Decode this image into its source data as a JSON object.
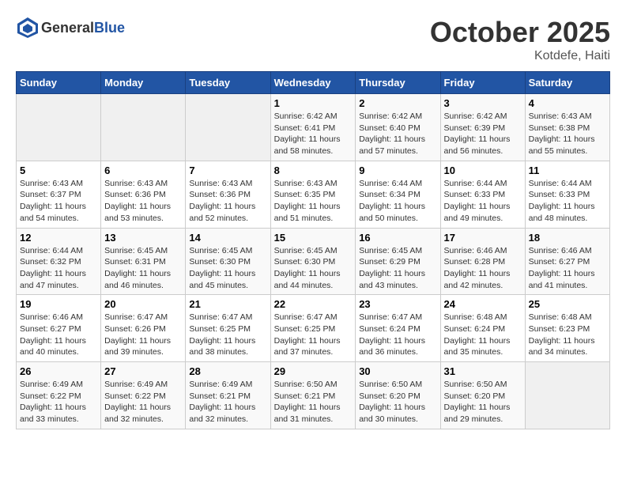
{
  "header": {
    "logo_general": "General",
    "logo_blue": "Blue",
    "month": "October 2025",
    "location": "Kotdefe, Haiti"
  },
  "weekdays": [
    "Sunday",
    "Monday",
    "Tuesday",
    "Wednesday",
    "Thursday",
    "Friday",
    "Saturday"
  ],
  "weeks": [
    [
      {
        "day": "",
        "sunrise": "",
        "sunset": "",
        "daylight": ""
      },
      {
        "day": "",
        "sunrise": "",
        "sunset": "",
        "daylight": ""
      },
      {
        "day": "",
        "sunrise": "",
        "sunset": "",
        "daylight": ""
      },
      {
        "day": "1",
        "sunrise": "Sunrise: 6:42 AM",
        "sunset": "Sunset: 6:41 PM",
        "daylight": "Daylight: 11 hours and 58 minutes."
      },
      {
        "day": "2",
        "sunrise": "Sunrise: 6:42 AM",
        "sunset": "Sunset: 6:40 PM",
        "daylight": "Daylight: 11 hours and 57 minutes."
      },
      {
        "day": "3",
        "sunrise": "Sunrise: 6:42 AM",
        "sunset": "Sunset: 6:39 PM",
        "daylight": "Daylight: 11 hours and 56 minutes."
      },
      {
        "day": "4",
        "sunrise": "Sunrise: 6:43 AM",
        "sunset": "Sunset: 6:38 PM",
        "daylight": "Daylight: 11 hours and 55 minutes."
      }
    ],
    [
      {
        "day": "5",
        "sunrise": "Sunrise: 6:43 AM",
        "sunset": "Sunset: 6:37 PM",
        "daylight": "Daylight: 11 hours and 54 minutes."
      },
      {
        "day": "6",
        "sunrise": "Sunrise: 6:43 AM",
        "sunset": "Sunset: 6:36 PM",
        "daylight": "Daylight: 11 hours and 53 minutes."
      },
      {
        "day": "7",
        "sunrise": "Sunrise: 6:43 AM",
        "sunset": "Sunset: 6:36 PM",
        "daylight": "Daylight: 11 hours and 52 minutes."
      },
      {
        "day": "8",
        "sunrise": "Sunrise: 6:43 AM",
        "sunset": "Sunset: 6:35 PM",
        "daylight": "Daylight: 11 hours and 51 minutes."
      },
      {
        "day": "9",
        "sunrise": "Sunrise: 6:44 AM",
        "sunset": "Sunset: 6:34 PM",
        "daylight": "Daylight: 11 hours and 50 minutes."
      },
      {
        "day": "10",
        "sunrise": "Sunrise: 6:44 AM",
        "sunset": "Sunset: 6:33 PM",
        "daylight": "Daylight: 11 hours and 49 minutes."
      },
      {
        "day": "11",
        "sunrise": "Sunrise: 6:44 AM",
        "sunset": "Sunset: 6:33 PM",
        "daylight": "Daylight: 11 hours and 48 minutes."
      }
    ],
    [
      {
        "day": "12",
        "sunrise": "Sunrise: 6:44 AM",
        "sunset": "Sunset: 6:32 PM",
        "daylight": "Daylight: 11 hours and 47 minutes."
      },
      {
        "day": "13",
        "sunrise": "Sunrise: 6:45 AM",
        "sunset": "Sunset: 6:31 PM",
        "daylight": "Daylight: 11 hours and 46 minutes."
      },
      {
        "day": "14",
        "sunrise": "Sunrise: 6:45 AM",
        "sunset": "Sunset: 6:30 PM",
        "daylight": "Daylight: 11 hours and 45 minutes."
      },
      {
        "day": "15",
        "sunrise": "Sunrise: 6:45 AM",
        "sunset": "Sunset: 6:30 PM",
        "daylight": "Daylight: 11 hours and 44 minutes."
      },
      {
        "day": "16",
        "sunrise": "Sunrise: 6:45 AM",
        "sunset": "Sunset: 6:29 PM",
        "daylight": "Daylight: 11 hours and 43 minutes."
      },
      {
        "day": "17",
        "sunrise": "Sunrise: 6:46 AM",
        "sunset": "Sunset: 6:28 PM",
        "daylight": "Daylight: 11 hours and 42 minutes."
      },
      {
        "day": "18",
        "sunrise": "Sunrise: 6:46 AM",
        "sunset": "Sunset: 6:27 PM",
        "daylight": "Daylight: 11 hours and 41 minutes."
      }
    ],
    [
      {
        "day": "19",
        "sunrise": "Sunrise: 6:46 AM",
        "sunset": "Sunset: 6:27 PM",
        "daylight": "Daylight: 11 hours and 40 minutes."
      },
      {
        "day": "20",
        "sunrise": "Sunrise: 6:47 AM",
        "sunset": "Sunset: 6:26 PM",
        "daylight": "Daylight: 11 hours and 39 minutes."
      },
      {
        "day": "21",
        "sunrise": "Sunrise: 6:47 AM",
        "sunset": "Sunset: 6:25 PM",
        "daylight": "Daylight: 11 hours and 38 minutes."
      },
      {
        "day": "22",
        "sunrise": "Sunrise: 6:47 AM",
        "sunset": "Sunset: 6:25 PM",
        "daylight": "Daylight: 11 hours and 37 minutes."
      },
      {
        "day": "23",
        "sunrise": "Sunrise: 6:47 AM",
        "sunset": "Sunset: 6:24 PM",
        "daylight": "Daylight: 11 hours and 36 minutes."
      },
      {
        "day": "24",
        "sunrise": "Sunrise: 6:48 AM",
        "sunset": "Sunset: 6:24 PM",
        "daylight": "Daylight: 11 hours and 35 minutes."
      },
      {
        "day": "25",
        "sunrise": "Sunrise: 6:48 AM",
        "sunset": "Sunset: 6:23 PM",
        "daylight": "Daylight: 11 hours and 34 minutes."
      }
    ],
    [
      {
        "day": "26",
        "sunrise": "Sunrise: 6:49 AM",
        "sunset": "Sunset: 6:22 PM",
        "daylight": "Daylight: 11 hours and 33 minutes."
      },
      {
        "day": "27",
        "sunrise": "Sunrise: 6:49 AM",
        "sunset": "Sunset: 6:22 PM",
        "daylight": "Daylight: 11 hours and 32 minutes."
      },
      {
        "day": "28",
        "sunrise": "Sunrise: 6:49 AM",
        "sunset": "Sunset: 6:21 PM",
        "daylight": "Daylight: 11 hours and 32 minutes."
      },
      {
        "day": "29",
        "sunrise": "Sunrise: 6:50 AM",
        "sunset": "Sunset: 6:21 PM",
        "daylight": "Daylight: 11 hours and 31 minutes."
      },
      {
        "day": "30",
        "sunrise": "Sunrise: 6:50 AM",
        "sunset": "Sunset: 6:20 PM",
        "daylight": "Daylight: 11 hours and 30 minutes."
      },
      {
        "day": "31",
        "sunrise": "Sunrise: 6:50 AM",
        "sunset": "Sunset: 6:20 PM",
        "daylight": "Daylight: 11 hours and 29 minutes."
      },
      {
        "day": "",
        "sunrise": "",
        "sunset": "",
        "daylight": ""
      }
    ]
  ]
}
